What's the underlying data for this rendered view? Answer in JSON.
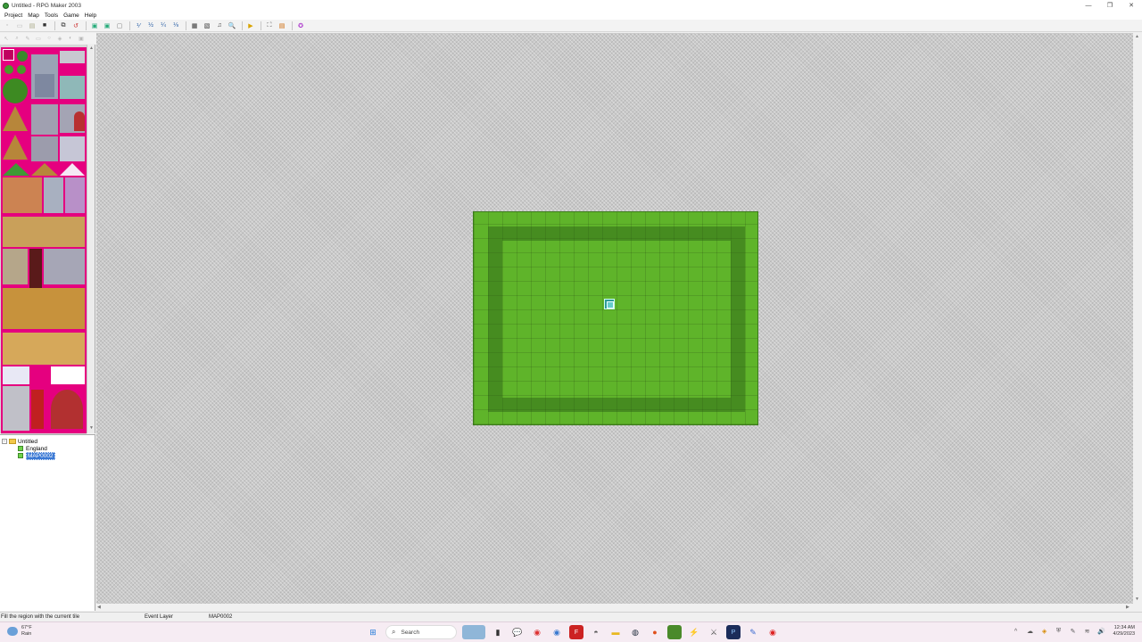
{
  "window": {
    "title": "Untitled - RPG Maker 2003",
    "controls": {
      "minimize": "—",
      "restore": "❐",
      "close": "✕"
    }
  },
  "menu": [
    "Project",
    "Map",
    "Tools",
    "Game",
    "Help"
  ],
  "tree": {
    "root": "Untitled",
    "items": [
      {
        "label": "England",
        "selected": false
      },
      {
        "label": "MAP0002",
        "selected": true
      }
    ]
  },
  "statusbar": {
    "hint": "Fill the region with the current tile",
    "layer": "Event Layer",
    "map": "MAP0002"
  },
  "taskbar": {
    "weather_temp": "67°F",
    "weather_desc": "Rain",
    "search_label": "Search",
    "clock_time": "12:34 AM",
    "clock_date": "4/29/2023"
  },
  "colors": {
    "palette_bg": "#e5007f",
    "grass": "#5fb42a",
    "selection": "#3a78d4"
  }
}
